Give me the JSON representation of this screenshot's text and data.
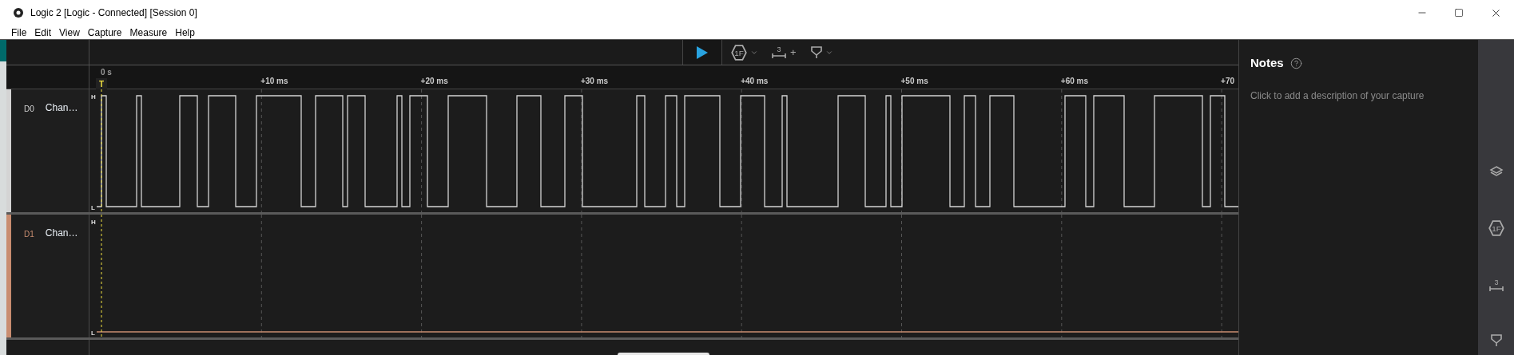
{
  "window": {
    "title": "Logic 2 [Logic - Connected] [Session 0]"
  },
  "menu": [
    "File",
    "Edit",
    "View",
    "Capture",
    "Measure",
    "Help"
  ],
  "toolbar": {
    "analyzer_glyph": "1F",
    "measure_glyph": "3",
    "measure_add": "+"
  },
  "ruler": {
    "origin": "0 s",
    "trigger": "T",
    "ticks": [
      "+10 ms",
      "+20 ms",
      "+30 ms",
      "+40 ms",
      "+50 ms",
      "+60 ms",
      "+70"
    ]
  },
  "channels": [
    {
      "id": "D0",
      "name": "Chan…",
      "color": "#d4d4d4",
      "high": "H",
      "low": "L",
      "kind": "pulses"
    },
    {
      "id": "D1",
      "name": "Chan…",
      "color": "#c98d70",
      "high": "H",
      "low": "L",
      "kind": "flat"
    }
  ],
  "notes": {
    "title": "Notes",
    "placeholder": "Click to add a description of your capture"
  },
  "side_rail": {
    "analyzer_glyph": "1F",
    "measure_glyph": "3"
  }
}
